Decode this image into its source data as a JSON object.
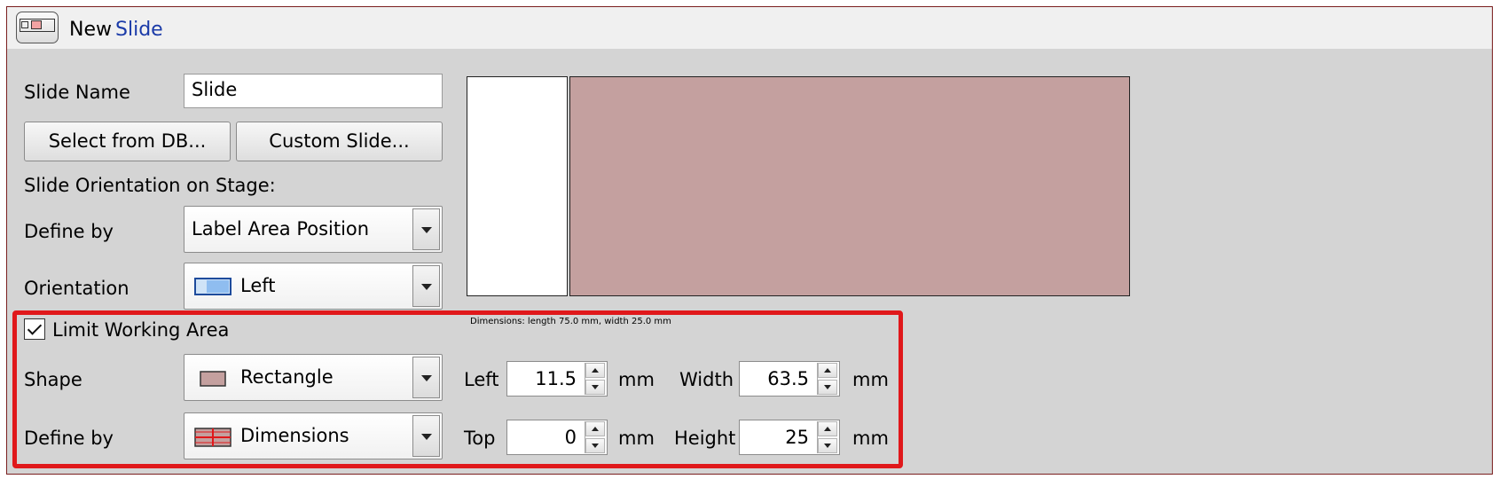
{
  "window": {
    "title_prefix": "New",
    "title_name": "Slide"
  },
  "form": {
    "slide_name_label": "Slide Name",
    "slide_name_value": "Slide",
    "select_db_button": "Select from DB...",
    "custom_slide_button": "Custom Slide...",
    "orientation_section_label": "Slide Orientation on Stage:",
    "define_by_label": "Define by",
    "define_by_value": "Label Area Position",
    "orientation_label": "Orientation",
    "orientation_value": "Left"
  },
  "preview": {
    "dimensions_text": "Dimensions: length 75.0 mm, width 25.0 mm",
    "slide_color": "#c4a09f"
  },
  "working_area": {
    "checkbox_label": "Limit Working Area",
    "checked": true,
    "shape_label": "Shape",
    "shape_value": "Rectangle",
    "define_by_label": "Define by",
    "define_by_value": "Dimensions",
    "left_label": "Left",
    "left_value": "11.5",
    "top_label": "Top",
    "top_value": "0",
    "width_label": "Width",
    "width_value": "63.5",
    "height_label": "Height",
    "height_value": "25",
    "unit": "mm"
  },
  "colors": {
    "highlight": "#e0181b",
    "title_accent": "#1a3aa8"
  }
}
